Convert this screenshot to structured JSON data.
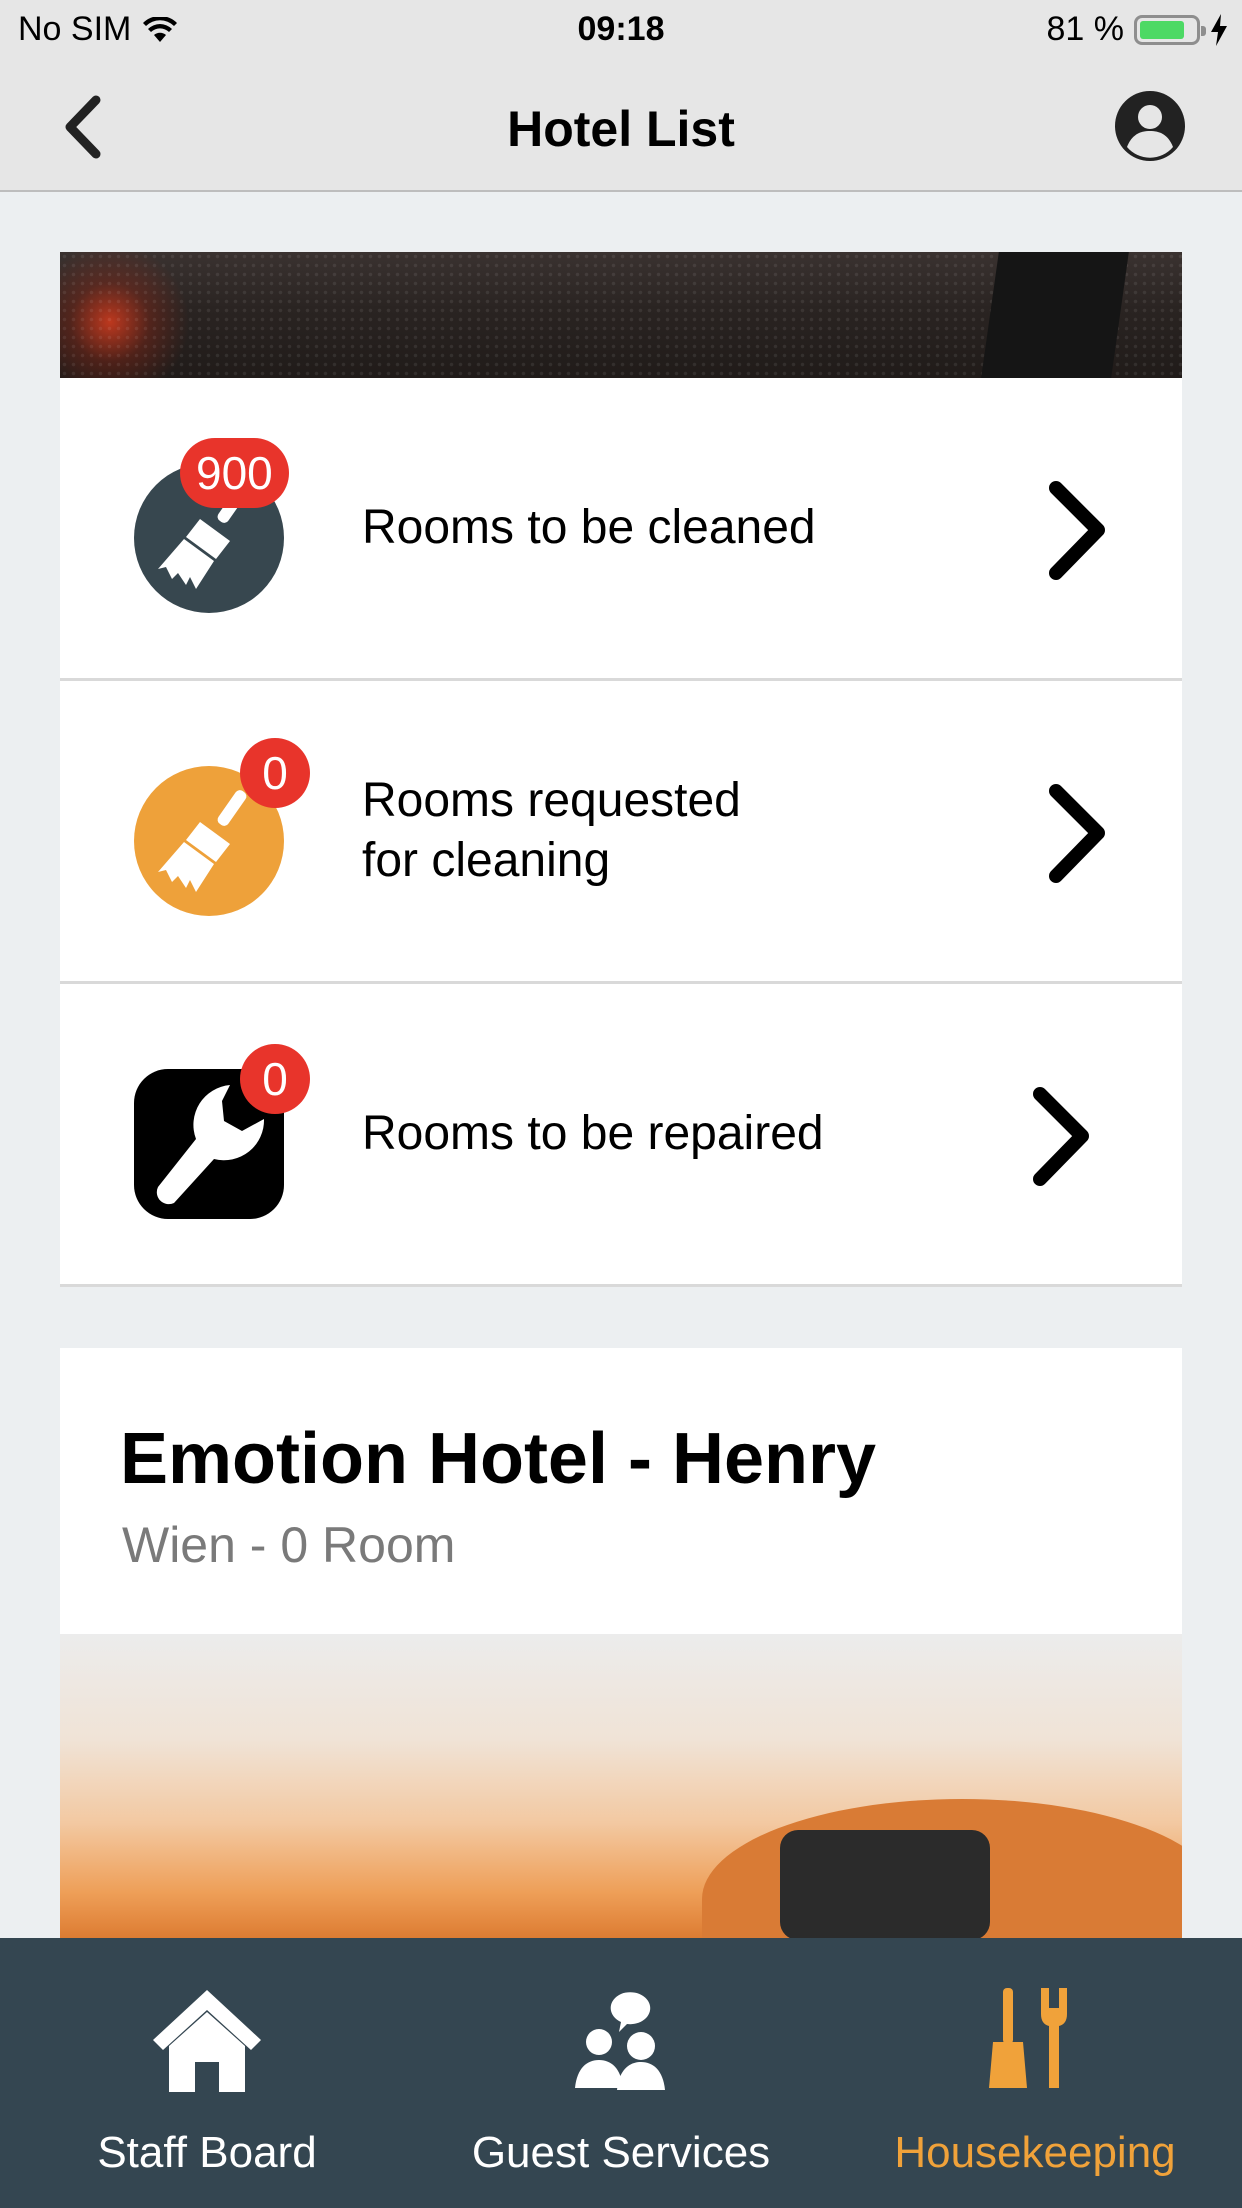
{
  "status_bar": {
    "carrier": "No SIM",
    "time": "09:18",
    "battery": "81 %",
    "battery_level": 0.81
  },
  "nav": {
    "title": "Hotel List"
  },
  "tasks": [
    {
      "label": "Rooms to be cleaned",
      "badge": "900",
      "icon": "broom-icon",
      "icon_color": "#37474f"
    },
    {
      "label": "Rooms requested\nfor cleaning",
      "badge": "0",
      "icon": "broom-icon",
      "icon_color": "#eea13a"
    },
    {
      "label": "Rooms to be repaired",
      "badge": "0",
      "icon": "wrench-icon",
      "icon_color": "#000000"
    }
  ],
  "hotel": {
    "name": "Emotion Hotel - Henry",
    "subtitle": "Wien - 0 Room"
  },
  "tabs": [
    {
      "label": "Staff Board",
      "icon": "home-icon",
      "active": false
    },
    {
      "label": "Guest Services",
      "icon": "guest-services-icon",
      "active": false
    },
    {
      "label": "Housekeeping",
      "icon": "housekeeping-icon",
      "active": true
    }
  ],
  "colors": {
    "badge": "#e8342b",
    "accent": "#f0a23a",
    "tab_bar": "#344651"
  }
}
